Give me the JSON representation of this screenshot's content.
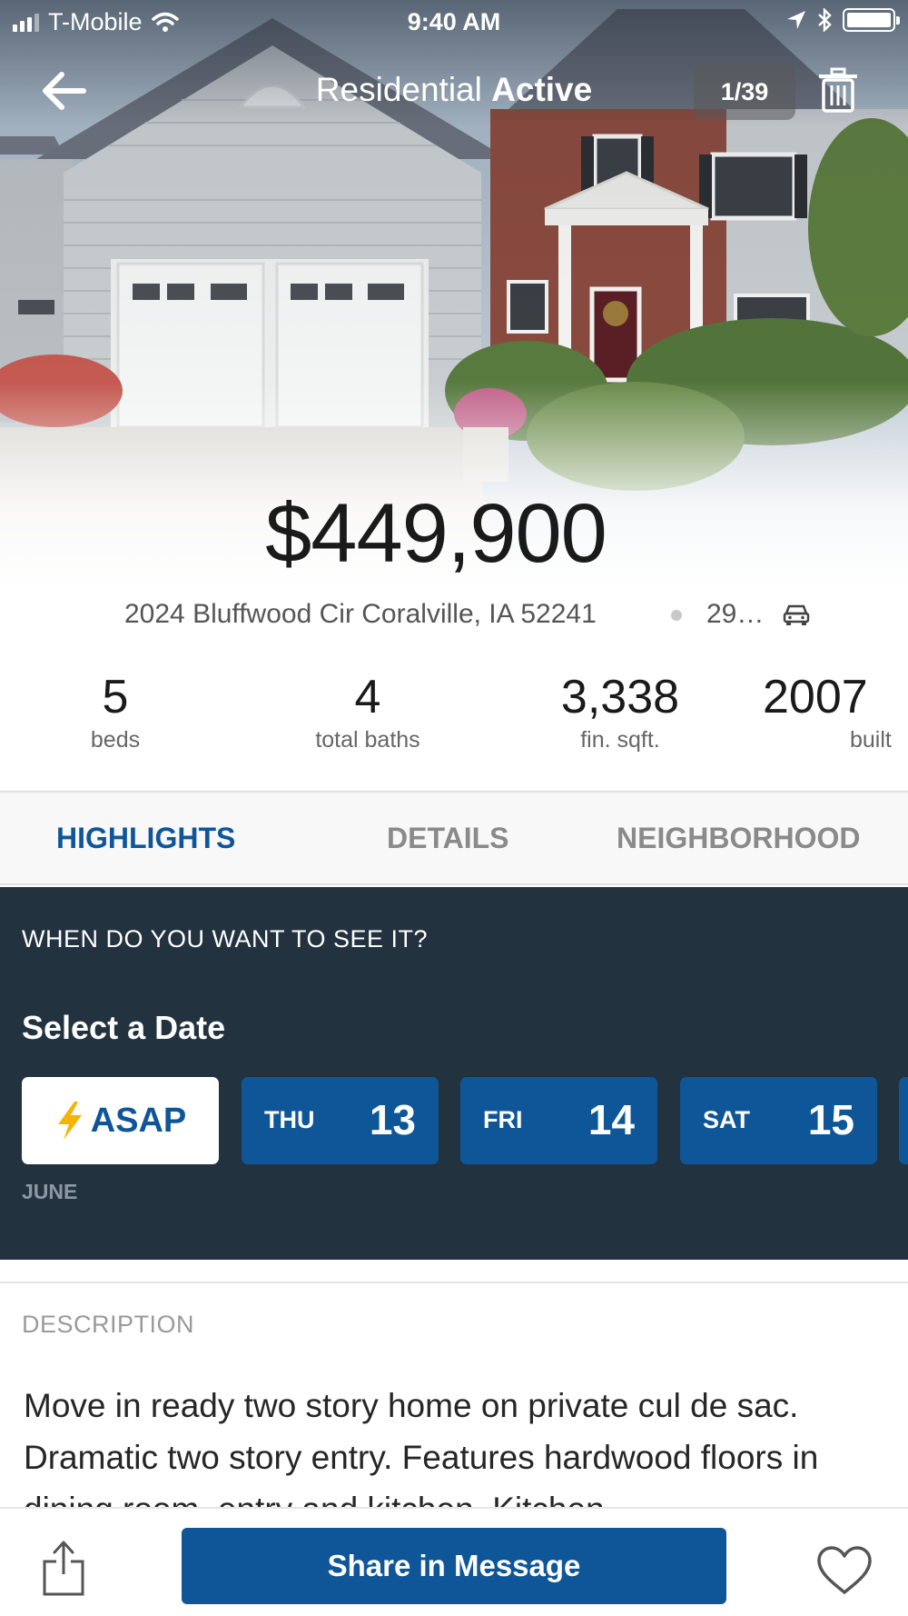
{
  "status_bar": {
    "carrier": "T-Mobile",
    "time": "9:40 AM"
  },
  "nav": {
    "title_prefix": "Residential",
    "title_status": "Active",
    "photo_counter": "1/39"
  },
  "listing": {
    "price": "$449,900",
    "address": "2024 Bluffwood Cir  Coralville, IA 52241",
    "drive_time": "29…",
    "stats": [
      {
        "value": "5",
        "label": "beds"
      },
      {
        "value": "4",
        "label": "total baths"
      },
      {
        "value": "3,338",
        "label": "fin. sqft."
      },
      {
        "value": "2007",
        "label": "built"
      }
    ]
  },
  "tabs": [
    {
      "label": "HIGHLIGHTS",
      "active": true
    },
    {
      "label": "DETAILS",
      "active": false
    },
    {
      "label": "NEIGHBORHOOD",
      "active": false
    }
  ],
  "schedule": {
    "heading": "WHEN DO YOU WANT TO SEE IT?",
    "title": "Select a Date",
    "asap_label": "ASAP",
    "days": [
      {
        "dow": "THU",
        "date": "13"
      },
      {
        "dow": "FRI",
        "date": "14"
      },
      {
        "dow": "SAT",
        "date": "15"
      }
    ],
    "month": "JUNE"
  },
  "description": {
    "label": "DESCRIPTION",
    "text": "Move in ready two story home on private cul de sac.  Dramatic two story entry.  Features hardwood floors in dining room, entry and kitchen.  Kitchen"
  },
  "bottom_bar": {
    "share_button_label": "Share in Message"
  },
  "colors": {
    "brand_blue": "#0f5699",
    "schedule_bg": "#23323f",
    "asap_bolt": "#f5b400"
  },
  "icons": [
    "back-arrow-icon",
    "trash-icon",
    "car-icon",
    "lightning-bolt-icon",
    "share-icon",
    "heart-icon",
    "wifi-icon",
    "location-arrow-icon",
    "bluetooth-icon",
    "battery-icon"
  ]
}
